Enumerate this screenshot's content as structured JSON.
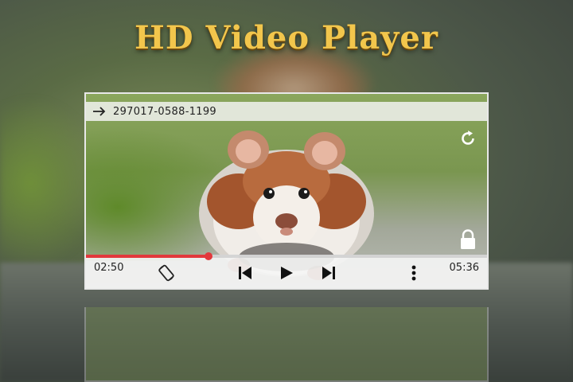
{
  "app": {
    "title": "HD Video Player"
  },
  "player": {
    "file_name": "297017-0588-1199",
    "time_elapsed": "02:50",
    "time_total": "05:36",
    "progress_fraction": 0.306,
    "accent_color": "#e2383c"
  },
  "icons": {
    "top_left": "arrow-right-icon",
    "rotate": "rotate-icon",
    "lock": "lock-icon",
    "screen_rotation": "screen-rotation-icon",
    "previous": "skip-previous-icon",
    "play": "play-icon",
    "next": "skip-next-icon",
    "more": "more-vertical-icon"
  }
}
